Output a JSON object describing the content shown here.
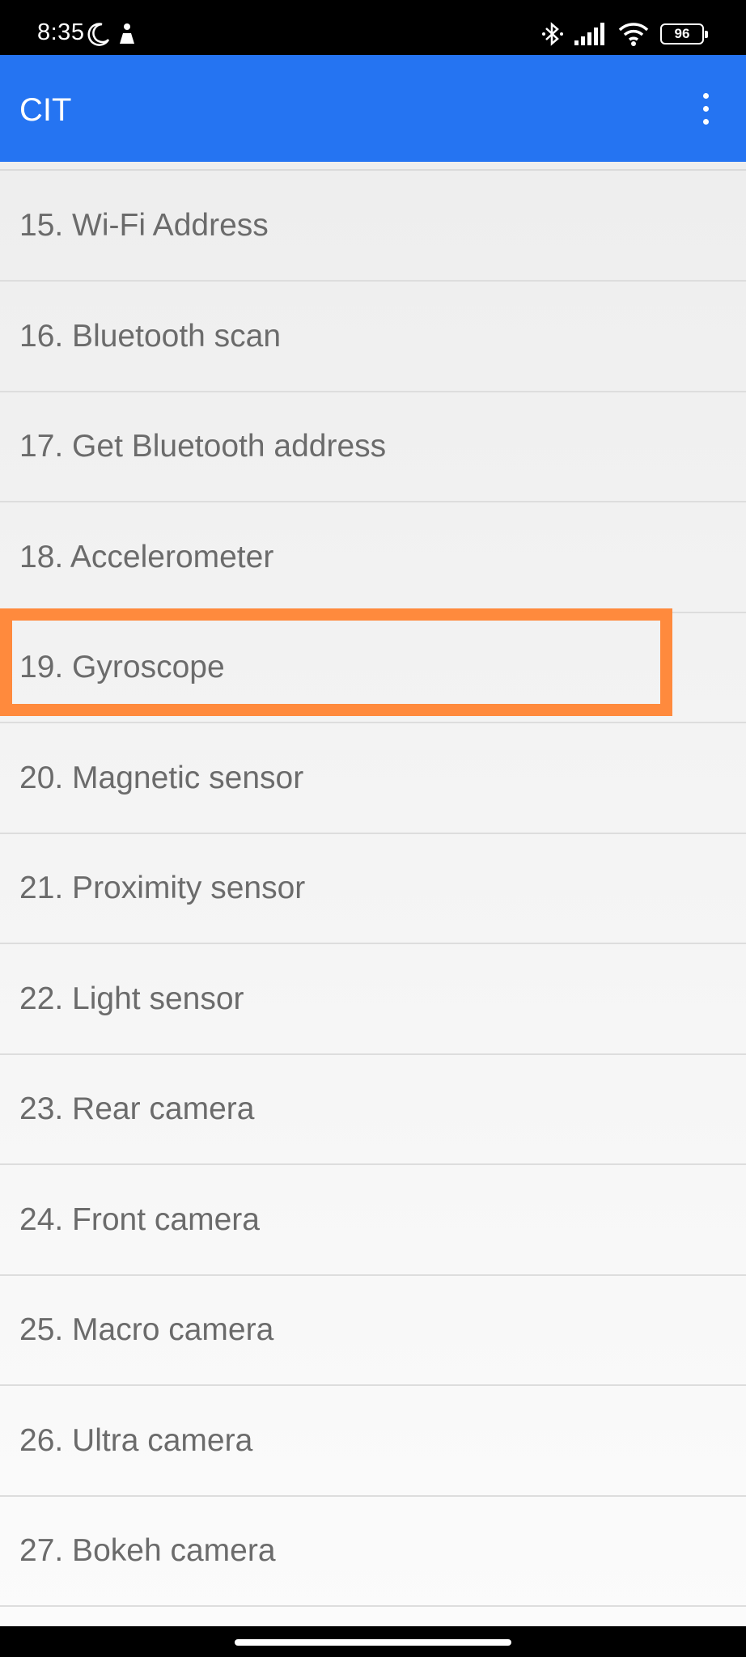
{
  "status_bar": {
    "time": "8:35",
    "left_icons": [
      "moon-icon",
      "accessibility-icon"
    ],
    "right_icons": [
      "bluetooth-icon",
      "signal-icon",
      "wifi-icon",
      "battery-icon"
    ],
    "battery_level": "96"
  },
  "app_bar": {
    "title": "CIT",
    "menu_icon": "more-vert-icon",
    "color": "#2574F2"
  },
  "list": {
    "items": [
      {
        "label": "15. Wi-Fi Address"
      },
      {
        "label": "16. Bluetooth scan"
      },
      {
        "label": "17. Get Bluetooth address"
      },
      {
        "label": "18. Accelerometer"
      },
      {
        "label": "19. Gyroscope",
        "highlighted": true
      },
      {
        "label": "20. Magnetic sensor"
      },
      {
        "label": "21. Proximity sensor"
      },
      {
        "label": "22. Light sensor"
      },
      {
        "label": "23. Rear camera"
      },
      {
        "label": "24. Front camera"
      },
      {
        "label": "25. Macro camera"
      },
      {
        "label": "26. Ultra camera"
      },
      {
        "label": "27. Bokeh camera"
      }
    ],
    "highlight_color": "#FF8A3D"
  }
}
